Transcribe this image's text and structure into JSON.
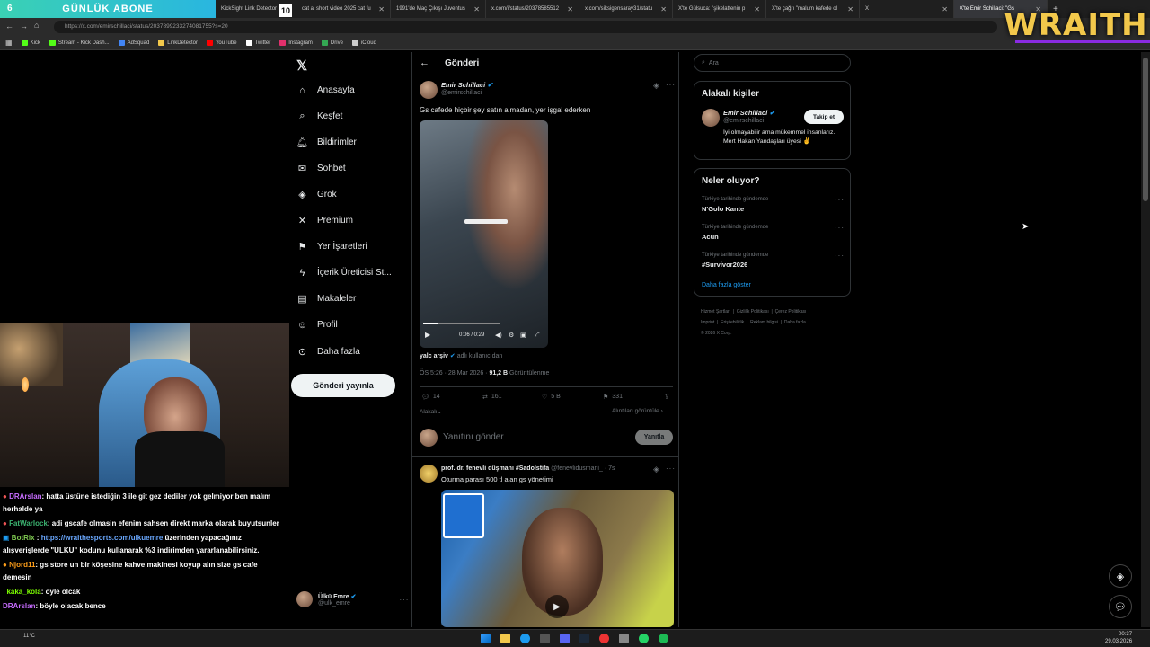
{
  "overlay": {
    "abone_text": "GÜNLÜK ABONE",
    "abone_count": "6",
    "brand": "WRAITH",
    "stream_count": "10"
  },
  "browser": {
    "tabs": [
      {
        "label": "KickSight Link Detector"
      },
      {
        "label": "cat ai short video 2025 cat fu"
      },
      {
        "label": "1991'de Maç Çıkışı Juventus"
      },
      {
        "label": "x.com/i/status/20378585512"
      },
      {
        "label": "x.com/siksigensaray31/statu"
      },
      {
        "label": "X'te Gülsuca: \"şikelattenin p"
      },
      {
        "label": "X'te çağrı \"malum kafede ol"
      },
      {
        "label": "X"
      },
      {
        "label": "X'te Emir Schillaci: \"Gs"
      }
    ],
    "url": "https://x.com/emirschillaci/status/2037899233274081755?s=20",
    "bookmarks": [
      "Kick",
      "Stream - Kick Dash...",
      "AdSquad",
      "LinkDetector",
      "YouTube",
      "Twitter",
      "Instagram",
      "Drive",
      "iCloud"
    ],
    "bookmark_colors": [
      "#53fc18",
      "#53fc18",
      "#4285f4",
      "#f2c84b",
      "#ff0000",
      "#ffffff",
      "#e1306c",
      "#34a853",
      "#cccccc"
    ]
  },
  "nav": {
    "items": [
      {
        "label": "Anasayfa",
        "icon": "home-icon",
        "glyph": "⌂"
      },
      {
        "label": "Keşfet",
        "icon": "search-icon",
        "glyph": "⌕"
      },
      {
        "label": "Bildirimler",
        "icon": "bell-icon",
        "glyph": "🔔︎"
      },
      {
        "label": "Sohbet",
        "icon": "mail-icon",
        "glyph": "✉"
      },
      {
        "label": "Grok",
        "icon": "grok-icon",
        "glyph": "◈"
      },
      {
        "label": "Premium",
        "icon": "x-premium-icon",
        "glyph": "✕"
      },
      {
        "label": "Yer İşaretleri",
        "icon": "bookmark-icon",
        "glyph": "⚑"
      },
      {
        "label": "İçerik Üreticisi St...",
        "icon": "lightning-icon",
        "glyph": "ϟ"
      },
      {
        "label": "Makaleler",
        "icon": "article-icon",
        "glyph": "▤"
      },
      {
        "label": "Profil",
        "icon": "profile-icon",
        "glyph": "☺"
      },
      {
        "label": "Daha fazla",
        "icon": "more-circle-icon",
        "glyph": "⊙"
      }
    ],
    "post_button": "Gönderi yayınla",
    "account": {
      "name": "Ülkü Emre",
      "handle": "@ulk_emre"
    }
  },
  "main": {
    "header": "Gönderi",
    "tweet": {
      "author": "Emir Schillaci",
      "handle": "@emirschillaci",
      "text": "Gs cafede hiçbir şey satın almadan, yer işgal ederken",
      "video_time": "0:06 / 0:29",
      "source_name": "yalc arşiv",
      "source_suffix": "adlı kullanıcıdan",
      "date": "ÖS 5:26 · 28 Mar 2026 ·",
      "views": "91,2 B",
      "views_label": "Görüntülenme",
      "replies": "14",
      "retweets": "161",
      "likes": "5 B",
      "bookmarks": "331",
      "more_related": "Alakalı",
      "quotes_link": "Alıntıları görüntüle"
    },
    "reply": {
      "placeholder": "Yanıtını gönder",
      "button": "Yanıtla"
    },
    "reply_tweet": {
      "author": "prof. dr. fenevli düşmanı #Sadolstifa",
      "handle": "@fenevlidusmani_",
      "time": "· 7s",
      "text": "Oturma parası 500 tl alan gs yönetimi"
    }
  },
  "right": {
    "search_placeholder": "Ara",
    "related": {
      "title": "Alakalı kişiler",
      "name": "Emir Schillaci",
      "handle": "@emirschillaci",
      "follow": "Takip et",
      "bio": "İyi olmayabilir ama mükemmel insanlarız. Mert Hakan Yandaşları üyesi ✌"
    },
    "trends": {
      "title": "Neler oluyor?",
      "items": [
        {
          "context": "Türkiye tarihinde gündemde",
          "topic": "N'Golo Kante"
        },
        {
          "context": "Türkiye tarihinde gündemde",
          "topic": "Acun"
        },
        {
          "context": "Türkiye tarihinde gündemde",
          "topic": "#Survivor2026"
        }
      ],
      "more": "Daha fazla göster"
    },
    "footer": [
      "Hizmet Şartları",
      "Gizlilik Politikası",
      "Çerez Politikası",
      "Imprint",
      "Erişilebilirlik",
      "Reklam bilgisi",
      "Daha fazla ...",
      "© 2026 X Corp."
    ]
  },
  "chat": {
    "messages": [
      {
        "user": "DRArslan",
        "color": "#c76cff",
        "text": ": hatta üstüne istediğin 3 ile git gez dediler yok gelmiyor ben malım herhalde ya"
      },
      {
        "user": "FatWarlock",
        "color": "#3cb371",
        "text": ": adi gscafe olmasin efenim sahsen direkt marka olarak buyutsunler"
      },
      {
        "user": "BotRix",
        "color": "#7ec850",
        "link": "https://wraithesports.com/ulkuemre",
        "text": " üzerinden yapacağınız alışverişlerde \"ULKU\" kodunu kullanarak %3 indirimden yararlanabilirsiniz."
      },
      {
        "user": "Njord11",
        "color": "#ff9f1a",
        "text": ": gs store un bir köşesine kahve makinesi koyup alın size gs cafe demesin"
      },
      {
        "user": "kaka_kola",
        "color": "#7cfc00",
        "text": ": öyle olcak"
      },
      {
        "user": "DRArslan",
        "color": "#c76cff",
        "text": ": böyle olacak bence"
      }
    ]
  },
  "taskbar": {
    "time": "00:37",
    "date": "29.03.2026",
    "weather": "11°C"
  }
}
